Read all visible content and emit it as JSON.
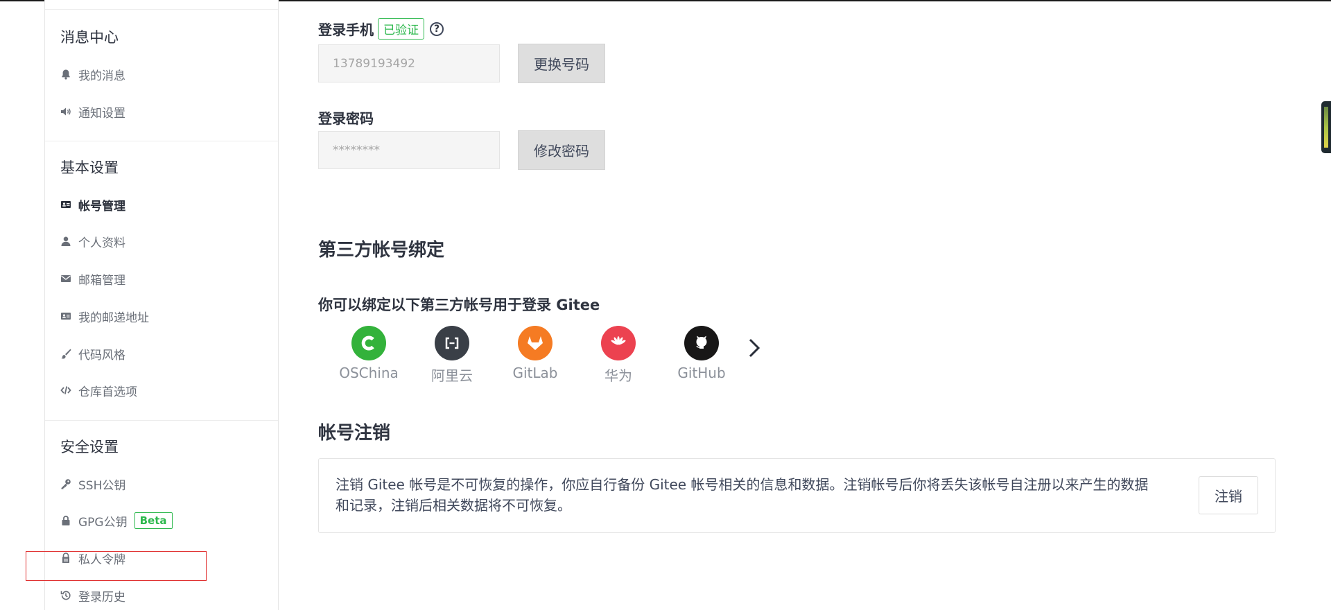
{
  "sidebar": {
    "sections": [
      {
        "title": "消息中心",
        "items": [
          {
            "label": "我的消息",
            "icon": "bell-icon"
          },
          {
            "label": "通知设置",
            "icon": "speaker-icon"
          }
        ]
      },
      {
        "title": "基本设置",
        "items": [
          {
            "label": "帐号管理",
            "icon": "id-card-icon",
            "active": true
          },
          {
            "label": "个人资料",
            "icon": "user-icon"
          },
          {
            "label": "邮箱管理",
            "icon": "envelope-icon"
          },
          {
            "label": "我的邮递地址",
            "icon": "address-card-icon"
          },
          {
            "label": "代码风格",
            "icon": "brush-icon"
          },
          {
            "label": "仓库首选项",
            "icon": "code-icon"
          }
        ]
      },
      {
        "title": "安全设置",
        "items": [
          {
            "label": "SSH公钥",
            "icon": "key-icon"
          },
          {
            "label": "GPG公钥",
            "icon": "lock-icon",
            "badge": "Beta"
          },
          {
            "label": "私人令牌",
            "icon": "token-icon"
          },
          {
            "label": "登录历史",
            "icon": "history-icon"
          }
        ]
      }
    ]
  },
  "account": {
    "phone_label": "登录手机",
    "verified_badge": "已验证",
    "phone_value": "13789193492",
    "change_phone_btn": "更换号码",
    "password_label": "登录密码",
    "password_value": "********",
    "change_password_btn": "修改密码"
  },
  "third_party": {
    "title": "第三方帐号绑定",
    "subtitle": "你可以绑定以下第三方帐号用于登录 Gitee",
    "providers": [
      {
        "name": "OSChina",
        "color": "#33b23b"
      },
      {
        "name": "阿里云",
        "color": "#3a3f47"
      },
      {
        "name": "GitLab",
        "color": "#f57b23"
      },
      {
        "name": "华为",
        "color": "#ec4250"
      },
      {
        "name": "GitHub",
        "color": "#181717"
      }
    ]
  },
  "deactivate": {
    "title": "帐号注销",
    "description": "注销 Gitee 帐号是不可恢复的操作，你应自行备份 Gitee 帐号相关的信息和数据。注销帐号后你将丢失该帐号自注册以来产生的数据和记录，注销后相关数据将不可恢复。",
    "button": "注销"
  }
}
